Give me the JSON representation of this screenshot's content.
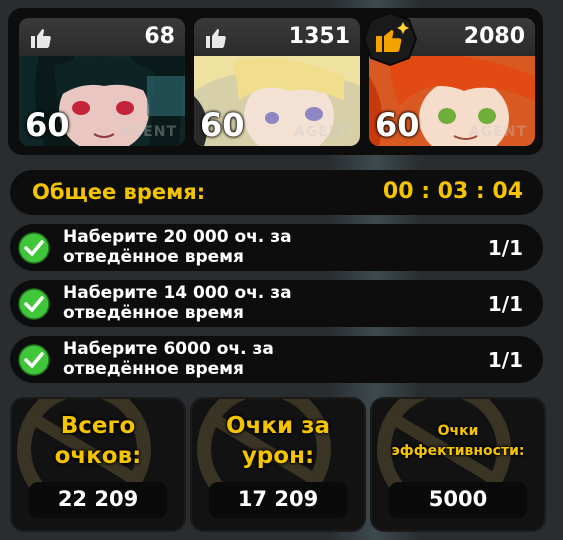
{
  "team": [
    {
      "likes": "68",
      "level": "60",
      "tag": "AGENT"
    },
    {
      "likes": "1351",
      "level": "60",
      "tag": "AGENT"
    },
    {
      "likes": "2080",
      "level": "60",
      "tag": "AGENT"
    }
  ],
  "time": {
    "label": "Общее время:",
    "value": "00 : 03 : 04"
  },
  "tasks": [
    {
      "line1": "Наберите 20 000 оч. за",
      "line2": "отведённое время",
      "progress": "1/1"
    },
    {
      "line1": "Наберите 14 000 оч. за",
      "line2": "отведённое время",
      "progress": "1/1"
    },
    {
      "line1": "Наберите 6000 оч. за",
      "line2": "отведённое время",
      "progress": "1/1"
    }
  ],
  "scores": [
    {
      "line1": "Всего",
      "line2": "очков:",
      "value": "22 209"
    },
    {
      "line1": "Очки за",
      "line2": "урон:",
      "value": "17 209"
    },
    {
      "line1": "Очки",
      "line2": "эффективности:",
      "value": "5000"
    }
  ],
  "colors": {
    "accent": "#f5c400",
    "check": "#3fc63a",
    "panel": "#0d0d0d"
  }
}
